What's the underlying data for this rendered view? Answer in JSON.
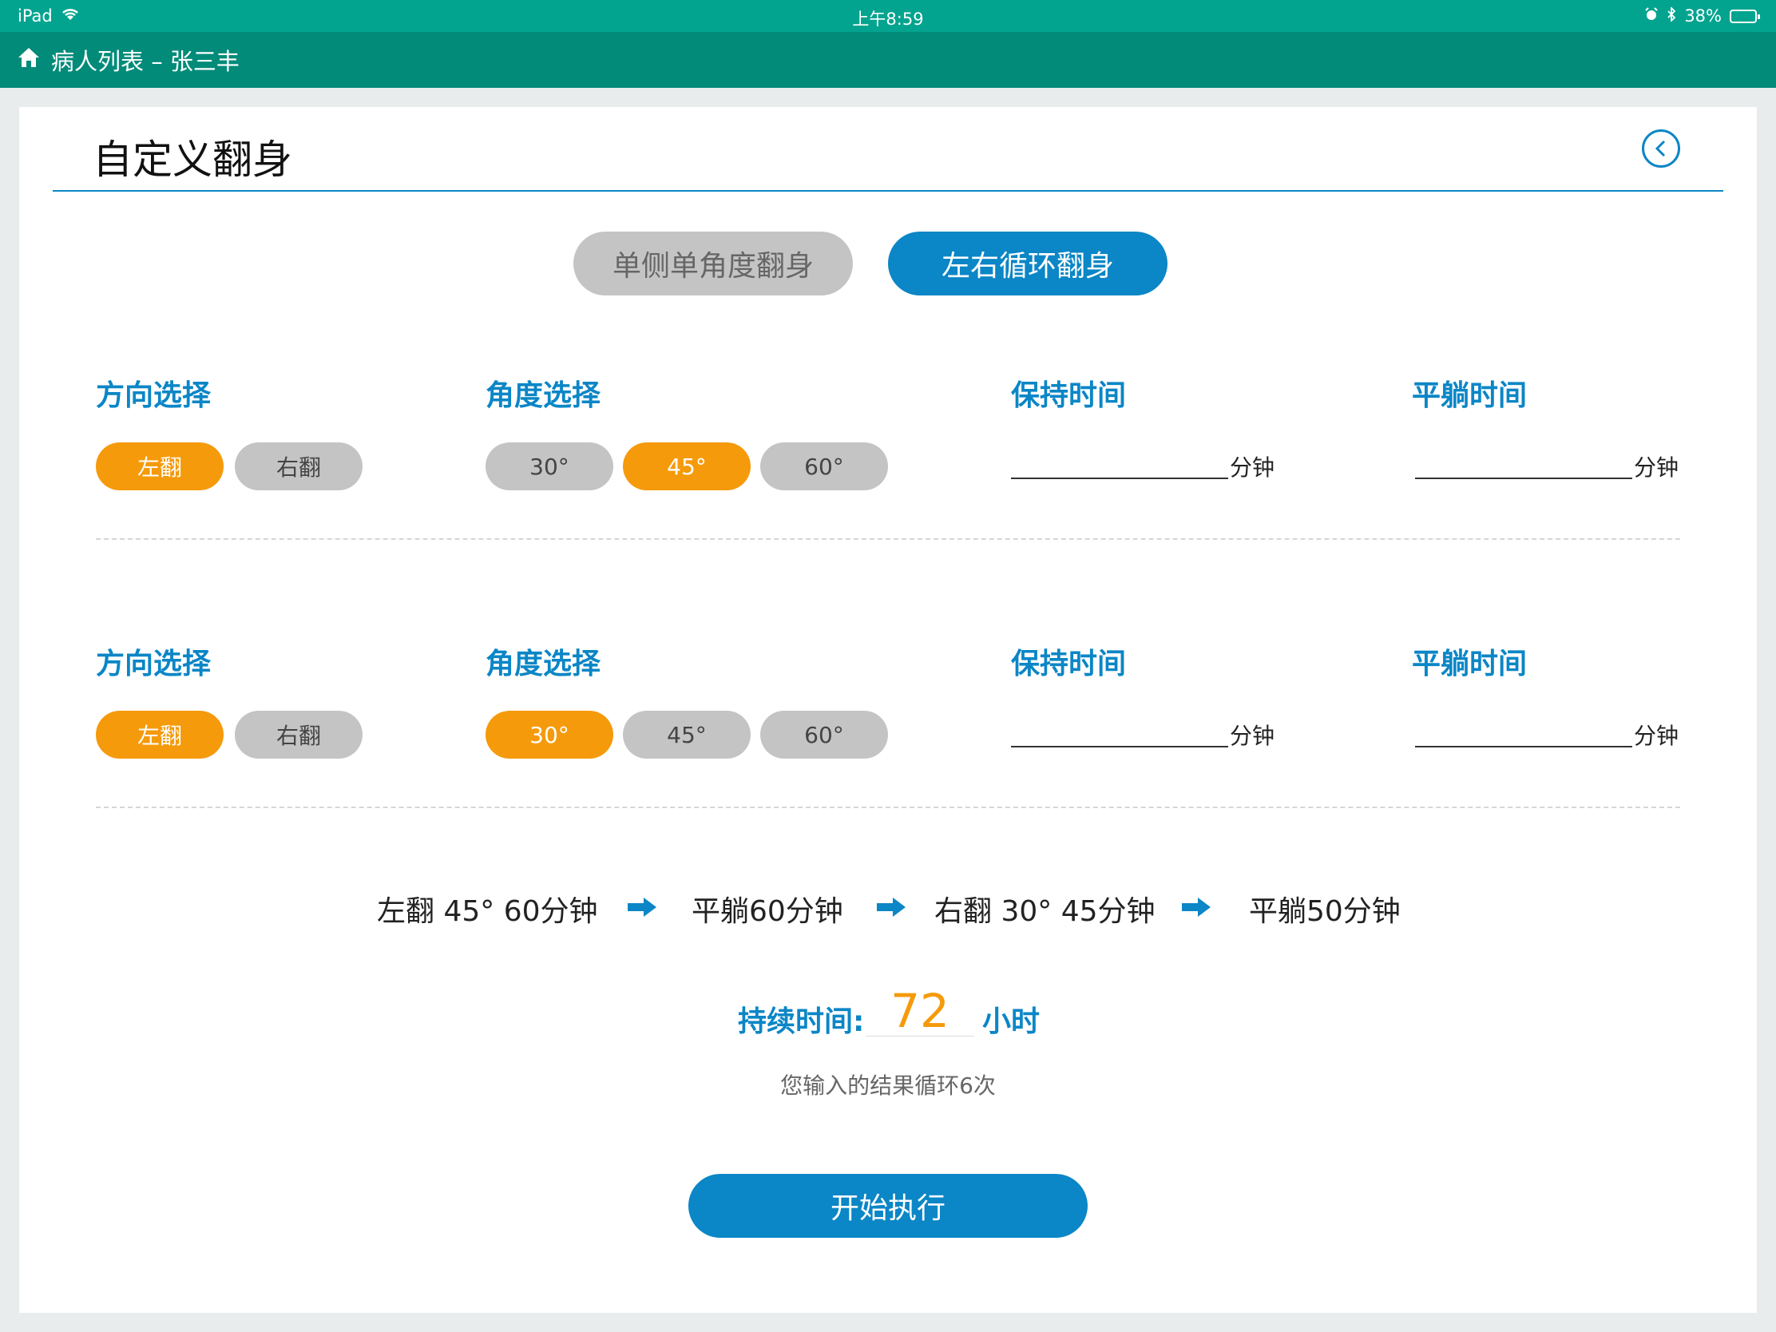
{
  "status_bar": {
    "device": "iPad",
    "time": "上午8:59",
    "battery_percent": "38%",
    "battery_level": 0.38
  },
  "nav": {
    "title": "病人列表 – 张三丰"
  },
  "page": {
    "title": "自定义翻身",
    "mode_tabs": [
      "单侧单角度翻身",
      "左右循环翻身"
    ],
    "selected_mode": "左右循环翻身"
  },
  "steps": [
    {
      "direction_label": "方向选择",
      "angle_label": "角度选择",
      "hold_label": "保持时间",
      "flat_label": "平躺时间",
      "direction_options": [
        "左翻",
        "右翻"
      ],
      "selected_direction": "左翻",
      "angle_options": [
        "30°",
        "45°",
        "60°"
      ],
      "selected_angle": "45°",
      "hold_value": "",
      "flat_value": "",
      "unit": "分钟"
    },
    {
      "direction_label": "方向选择",
      "angle_label": "角度选择",
      "hold_label": "保持时间",
      "flat_label": "平躺时间",
      "direction_options": [
        "左翻",
        "右翻"
      ],
      "selected_direction": "左翻",
      "angle_options": [
        "30°",
        "45°",
        "60°"
      ],
      "selected_angle": "30°",
      "hold_value": "",
      "flat_value": "",
      "unit": "分钟"
    }
  ],
  "summary": {
    "sequence": [
      "左翻 45° 60分钟",
      "平躺60分钟",
      "右翻 30° 45分钟",
      "平躺50分钟"
    ]
  },
  "duration": {
    "label": "持续时间:",
    "value": "72",
    "unit": "小时",
    "result_text": "您输入的结果循环6次"
  },
  "actions": {
    "start_label": "开始执行"
  },
  "colors": {
    "status_bar": "#03a48f",
    "nav_bar": "#038b7a",
    "accent_blue": "#0b86c6",
    "selected_orange": "#f59a0b",
    "unselected_grey": "#c4c4c4"
  }
}
